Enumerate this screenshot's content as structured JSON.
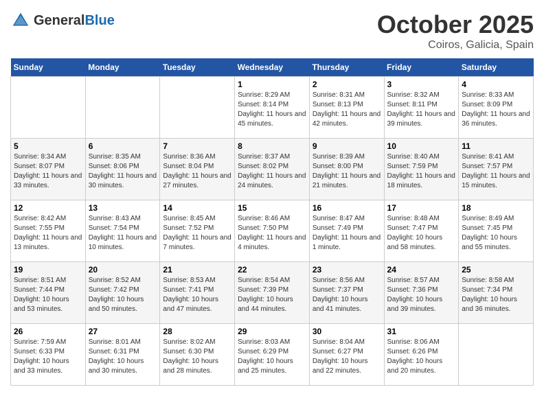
{
  "header": {
    "logo_general": "General",
    "logo_blue": "Blue",
    "month": "October 2025",
    "location": "Coiros, Galicia, Spain"
  },
  "days_of_week": [
    "Sunday",
    "Monday",
    "Tuesday",
    "Wednesday",
    "Thursday",
    "Friday",
    "Saturday"
  ],
  "weeks": [
    [
      {
        "day": "",
        "info": ""
      },
      {
        "day": "",
        "info": ""
      },
      {
        "day": "",
        "info": ""
      },
      {
        "day": "1",
        "info": "Sunrise: 8:29 AM\nSunset: 8:14 PM\nDaylight: 11 hours and 45 minutes."
      },
      {
        "day": "2",
        "info": "Sunrise: 8:31 AM\nSunset: 8:13 PM\nDaylight: 11 hours and 42 minutes."
      },
      {
        "day": "3",
        "info": "Sunrise: 8:32 AM\nSunset: 8:11 PM\nDaylight: 11 hours and 39 minutes."
      },
      {
        "day": "4",
        "info": "Sunrise: 8:33 AM\nSunset: 8:09 PM\nDaylight: 11 hours and 36 minutes."
      }
    ],
    [
      {
        "day": "5",
        "info": "Sunrise: 8:34 AM\nSunset: 8:07 PM\nDaylight: 11 hours and 33 minutes."
      },
      {
        "day": "6",
        "info": "Sunrise: 8:35 AM\nSunset: 8:06 PM\nDaylight: 11 hours and 30 minutes."
      },
      {
        "day": "7",
        "info": "Sunrise: 8:36 AM\nSunset: 8:04 PM\nDaylight: 11 hours and 27 minutes."
      },
      {
        "day": "8",
        "info": "Sunrise: 8:37 AM\nSunset: 8:02 PM\nDaylight: 11 hours and 24 minutes."
      },
      {
        "day": "9",
        "info": "Sunrise: 8:39 AM\nSunset: 8:00 PM\nDaylight: 11 hours and 21 minutes."
      },
      {
        "day": "10",
        "info": "Sunrise: 8:40 AM\nSunset: 7:59 PM\nDaylight: 11 hours and 18 minutes."
      },
      {
        "day": "11",
        "info": "Sunrise: 8:41 AM\nSunset: 7:57 PM\nDaylight: 11 hours and 15 minutes."
      }
    ],
    [
      {
        "day": "12",
        "info": "Sunrise: 8:42 AM\nSunset: 7:55 PM\nDaylight: 11 hours and 13 minutes."
      },
      {
        "day": "13",
        "info": "Sunrise: 8:43 AM\nSunset: 7:54 PM\nDaylight: 11 hours and 10 minutes."
      },
      {
        "day": "14",
        "info": "Sunrise: 8:45 AM\nSunset: 7:52 PM\nDaylight: 11 hours and 7 minutes."
      },
      {
        "day": "15",
        "info": "Sunrise: 8:46 AM\nSunset: 7:50 PM\nDaylight: 11 hours and 4 minutes."
      },
      {
        "day": "16",
        "info": "Sunrise: 8:47 AM\nSunset: 7:49 PM\nDaylight: 11 hours and 1 minute."
      },
      {
        "day": "17",
        "info": "Sunrise: 8:48 AM\nSunset: 7:47 PM\nDaylight: 10 hours and 58 minutes."
      },
      {
        "day": "18",
        "info": "Sunrise: 8:49 AM\nSunset: 7:45 PM\nDaylight: 10 hours and 55 minutes."
      }
    ],
    [
      {
        "day": "19",
        "info": "Sunrise: 8:51 AM\nSunset: 7:44 PM\nDaylight: 10 hours and 53 minutes."
      },
      {
        "day": "20",
        "info": "Sunrise: 8:52 AM\nSunset: 7:42 PM\nDaylight: 10 hours and 50 minutes."
      },
      {
        "day": "21",
        "info": "Sunrise: 8:53 AM\nSunset: 7:41 PM\nDaylight: 10 hours and 47 minutes."
      },
      {
        "day": "22",
        "info": "Sunrise: 8:54 AM\nSunset: 7:39 PM\nDaylight: 10 hours and 44 minutes."
      },
      {
        "day": "23",
        "info": "Sunrise: 8:56 AM\nSunset: 7:37 PM\nDaylight: 10 hours and 41 minutes."
      },
      {
        "day": "24",
        "info": "Sunrise: 8:57 AM\nSunset: 7:36 PM\nDaylight: 10 hours and 39 minutes."
      },
      {
        "day": "25",
        "info": "Sunrise: 8:58 AM\nSunset: 7:34 PM\nDaylight: 10 hours and 36 minutes."
      }
    ],
    [
      {
        "day": "26",
        "info": "Sunrise: 7:59 AM\nSunset: 6:33 PM\nDaylight: 10 hours and 33 minutes."
      },
      {
        "day": "27",
        "info": "Sunrise: 8:01 AM\nSunset: 6:31 PM\nDaylight: 10 hours and 30 minutes."
      },
      {
        "day": "28",
        "info": "Sunrise: 8:02 AM\nSunset: 6:30 PM\nDaylight: 10 hours and 28 minutes."
      },
      {
        "day": "29",
        "info": "Sunrise: 8:03 AM\nSunset: 6:29 PM\nDaylight: 10 hours and 25 minutes."
      },
      {
        "day": "30",
        "info": "Sunrise: 8:04 AM\nSunset: 6:27 PM\nDaylight: 10 hours and 22 minutes."
      },
      {
        "day": "31",
        "info": "Sunrise: 8:06 AM\nSunset: 6:26 PM\nDaylight: 10 hours and 20 minutes."
      },
      {
        "day": "",
        "info": ""
      }
    ]
  ]
}
